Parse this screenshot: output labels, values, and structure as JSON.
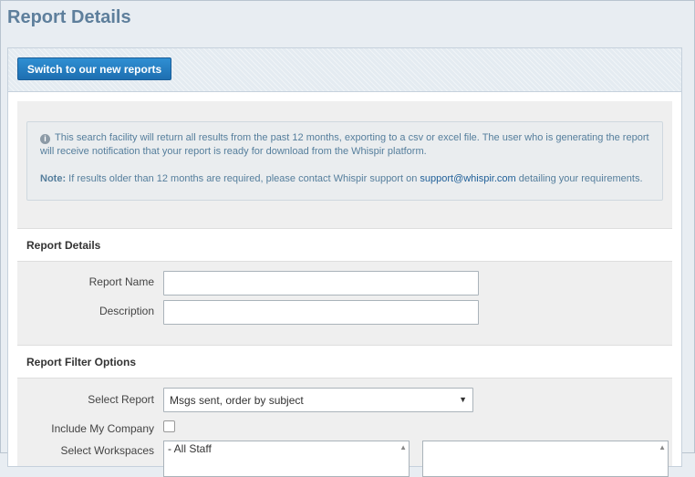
{
  "page": {
    "title": "Report Details"
  },
  "header": {
    "switch_button": "Switch to our new reports"
  },
  "info": {
    "text": "This search facility will return all results from the past 12 months, exporting to a csv or excel file. The user who is generating the report will receive notification that your report is ready for download from the Whispir platform.",
    "note_label": "Note:",
    "note_text_before": " If results older than 12 months are required, please contact Whispir support on ",
    "note_link": "support@whispir.com",
    "note_text_after": " detailing your requirements."
  },
  "report_details": {
    "title": "Report Details",
    "name_label": "Report Name",
    "name_value": "",
    "description_label": "Description",
    "description_value": ""
  },
  "filter_options": {
    "title": "Report Filter Options",
    "select_report_label": "Select Report",
    "select_report_value": "Msgs sent, order by subject",
    "include_company_label": "Include My Company",
    "include_company_checked": false,
    "workspaces_label": "Select Workspaces",
    "workspaces_options": [
      "- All Staff"
    ]
  },
  "colors": {
    "title_blue": "#5e7f9c",
    "button_blue": "#1e6fb1",
    "info_text": "#557e9c",
    "link": "#1f5f98"
  },
  "icons": {
    "info": "info-circle-icon",
    "dropdown": "chevron-down-icon",
    "scroll": "chevron-up-icon"
  }
}
